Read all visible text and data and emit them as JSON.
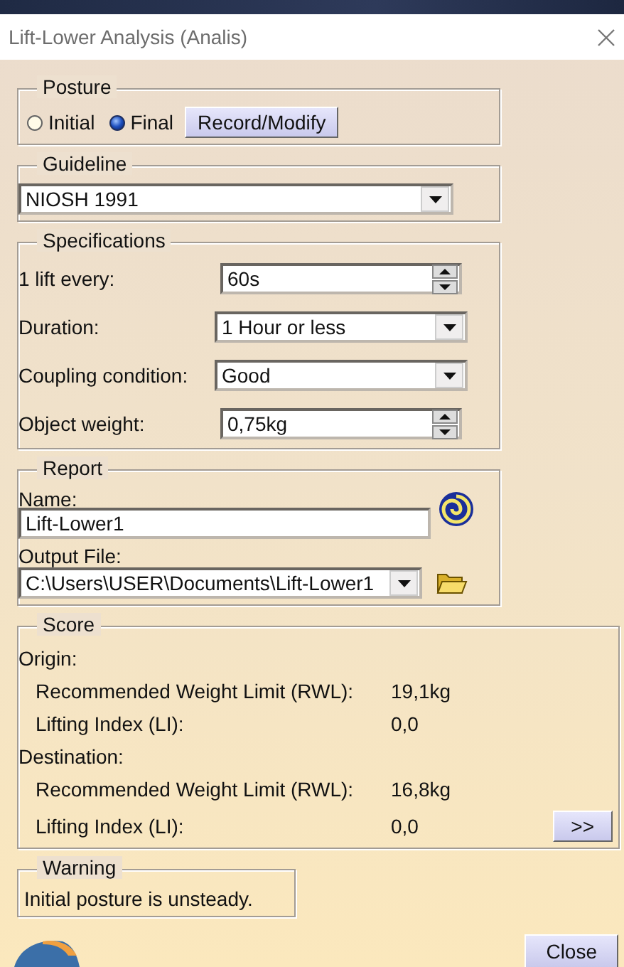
{
  "window": {
    "title": "Lift-Lower Analysis (Analis)"
  },
  "posture": {
    "title": "Posture",
    "options": [
      {
        "label": "Initial",
        "selected": false
      },
      {
        "label": "Final",
        "selected": true
      }
    ],
    "button": "Record/Modify"
  },
  "guideline": {
    "title": "Guideline",
    "value": "NIOSH 1991"
  },
  "specifications": {
    "title": "Specifications",
    "fields": [
      {
        "label": "1 lift every:",
        "value": "60s",
        "kind": "spin"
      },
      {
        "label": "Duration:",
        "value": "1 Hour or less",
        "kind": "dropdown"
      },
      {
        "label": "Coupling condition:",
        "value": "Good",
        "kind": "dropdown"
      },
      {
        "label": "Object weight:",
        "value": "0,75kg",
        "kind": "spin"
      }
    ]
  },
  "report": {
    "title": "Report",
    "name_label": "Name:",
    "name_value": "Lift-Lower1",
    "output_label": "Output File:",
    "output_value": "C:\\Users\\USER\\Documents\\Lift-Lower1"
  },
  "score": {
    "title": "Score",
    "sections": [
      {
        "heading": "Origin:",
        "rows": [
          {
            "label": "Recommended Weight Limit (RWL):",
            "value": "19,1kg"
          },
          {
            "label": "Lifting Index (LI):",
            "value": "0,0"
          }
        ]
      },
      {
        "heading": "Destination:",
        "rows": [
          {
            "label": "Recommended Weight Limit (RWL):",
            "value": "16,8kg"
          },
          {
            "label": "Lifting Index (LI):",
            "value": "0,0"
          }
        ]
      }
    ],
    "more_button": ">>"
  },
  "warning": {
    "title": "Warning",
    "message": "Initial posture is unsteady."
  },
  "close_button": "Close"
}
